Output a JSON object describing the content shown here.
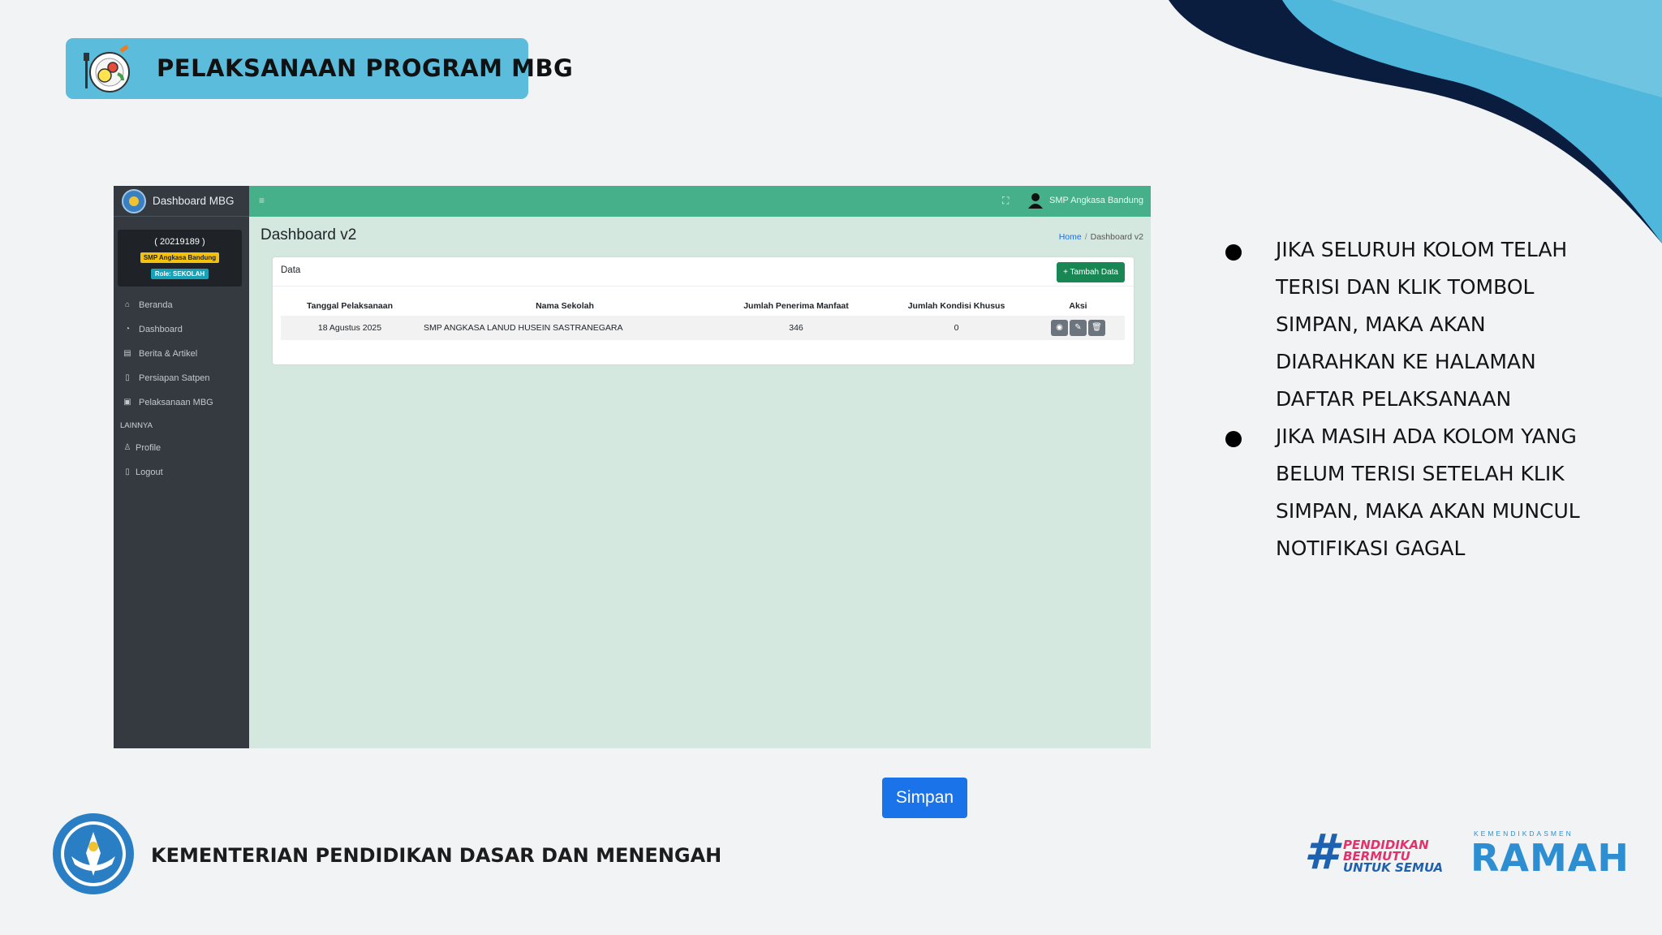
{
  "header": {
    "title": "PELAKSANAAN PROGRAM MBG"
  },
  "app": {
    "brand": "Dashboard MBG",
    "user": {
      "id": "( 20219189 )",
      "school_badge": "SMP Angkasa Bandung",
      "role_badge": "Role: SEKOLAH"
    },
    "nav": {
      "items": [
        {
          "label": "Beranda",
          "icon": "home-icon"
        },
        {
          "label": "Dashboard",
          "icon": "dashboard-icon"
        },
        {
          "label": "Berita & Artikel",
          "icon": "news-icon"
        },
        {
          "label": "Persiapan Satpen",
          "icon": "file-icon"
        },
        {
          "label": "Pelaksanaan MBG",
          "icon": "chart-icon"
        }
      ],
      "section_label": "LAINNYA",
      "extra": [
        {
          "label": "Profile",
          "icon": "user-cog-icon"
        },
        {
          "label": "Logout",
          "icon": "door-icon"
        }
      ]
    },
    "topbar": {
      "user_name": "SMP Angkasa Bandung"
    },
    "page_title": "Dashboard v2",
    "breadcrumb": {
      "home": "Home",
      "separator": "/",
      "current": "Dashboard v2"
    },
    "card": {
      "title": "Data",
      "add_button": "+ Tambah Data",
      "columns": [
        "Tanggal Pelaksanaan",
        "Nama Sekolah",
        "Jumlah Penerima Manfaat",
        "Jumlah Kondisi Khusus",
        "Aksi"
      ],
      "rows": [
        {
          "tanggal": "18 Agustus 2025",
          "sekolah": "SMP ANGKASA LANUD HUSEIN SASTRANEGARA",
          "penerima": "346",
          "kondisi": "0"
        }
      ]
    },
    "colors": {
      "topbar": "#45b089",
      "sidebar": "#343a40",
      "content_bg": "#d5e8e0"
    }
  },
  "bullets": [
    "JIKA SELURUH KOLOM TELAH TERISI DAN KLIK TOMBOL SIMPAN, MAKA AKAN DIARAHKAN KE HALAMAN DAFTAR PELAKSANAAN",
    "JIKA MASIH ADA KOLOM YANG BELUM TERISI SETELAH KLIK SIMPAN, MAKA AKAN MUNCUL NOTIFIKASI GAGAL"
  ],
  "save_button": "Simpan",
  "footer": {
    "ministry": "KEMENTERIAN PENDIDIKAN DASAR DAN MENENGAH",
    "hashtag": {
      "mark": "#",
      "line1": "PENDIDIKAN",
      "line2": "BERMUTU",
      "line3": "UNTUK SEMUA"
    },
    "ramah": {
      "small": "KEMENDIKDASMEN",
      "big": "RAMAH"
    }
  }
}
